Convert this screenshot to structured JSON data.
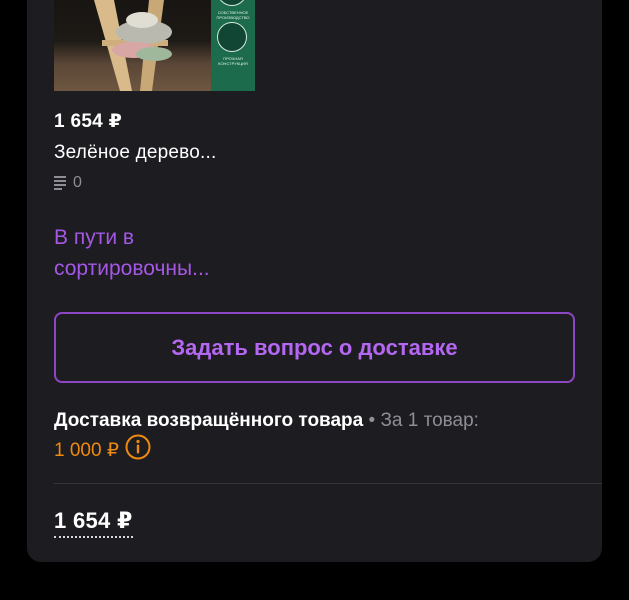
{
  "product": {
    "price": "1 654 ₽",
    "title": "Зелёное дерево...",
    "review_count": "0",
    "badges": [
      "СОБСТВЕННОЕ ПРОИЗВОДСТВО",
      "ПРОЧНАЯ КОНСТРУКЦИЯ"
    ]
  },
  "status": {
    "text": "В пути в сортировочны..."
  },
  "actions": {
    "ask_delivery_label": "Задать вопрос о доставке"
  },
  "delivery": {
    "label": "Доставка возвращённого товара",
    "separator": "•",
    "per_item": "За 1 товар:",
    "cost": "1 000 ₽"
  },
  "total": {
    "amount": "1 654 ₽"
  },
  "colors": {
    "card_bg": "#1d1c21",
    "accent_purple": "#a557e6",
    "cost_orange": "#ef8a10",
    "muted": "#8f8e96"
  }
}
